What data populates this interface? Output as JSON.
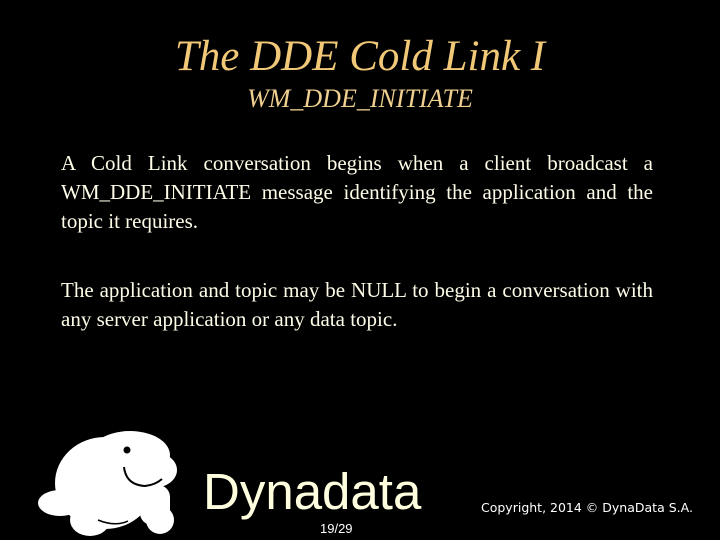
{
  "slide": {
    "title": "The DDE Cold Link I",
    "subtitle": "WM_DDE_INITIATE",
    "paragraphs": [
      "A Cold Link conversation begins when a client broadcast a WM_DDE_INITIATE message identifying the application and the topic it requires.",
      "The application and topic may be NULL to begin a conversation with any server application or any data topic."
    ],
    "footer": {
      "brand": "Dynadata",
      "page_number": "19/29",
      "copyright": "Copyright, 2014 © DynaData S.A."
    },
    "mascot_icon": "manatee-mascot-icon"
  }
}
